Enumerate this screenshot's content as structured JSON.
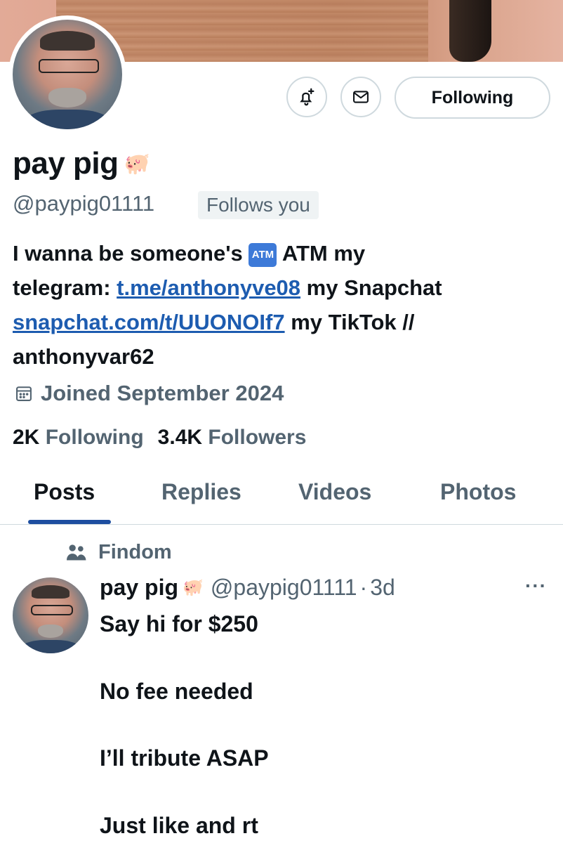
{
  "profile": {
    "name": "pay pig",
    "name_emoji": "🐖",
    "handle": "@paypig01111",
    "follows_you_badge": "Follows you",
    "bio": {
      "line1_a": "I wanna be someone's",
      "atm_emoji": "ATM",
      "line1_b": "ATM my",
      "telegram_label": "telegram:",
      "telegram_link": "t.me/anthonyve08",
      "snapchat_label": "my Snapchat",
      "snapchat_link": "snapchat.com/t/UUONOIf7",
      "tiktok_label": "my TikTok //",
      "tiktok_handle": "anthonyvar62"
    },
    "joined": "Joined September 2024",
    "following_count": "2K",
    "following_label": "Following",
    "followers_count": "3.4K",
    "followers_label": "Followers"
  },
  "actions": {
    "notify_icon": "bell-plus-icon",
    "message_icon": "envelope-icon",
    "following_button": "Following"
  },
  "tabs": [
    {
      "label": "Posts",
      "active": true
    },
    {
      "label": "Replies",
      "active": false
    },
    {
      "label": "Videos",
      "active": false
    },
    {
      "label": "Photos",
      "active": false
    }
  ],
  "post": {
    "social_context": "Findom",
    "author_name": "pay pig",
    "author_emoji": "🐖",
    "author_handle": "@paypig01111",
    "separator": "·",
    "time": "3d",
    "more": "···",
    "lines": [
      "Say hi for $250",
      "No fee needed",
      "I’ll tribute ASAP",
      "Just like and rt"
    ]
  },
  "colors": {
    "link": "#1d5cb0",
    "secondary_text": "#536471",
    "tab_indicator": "#1d4ea0"
  }
}
